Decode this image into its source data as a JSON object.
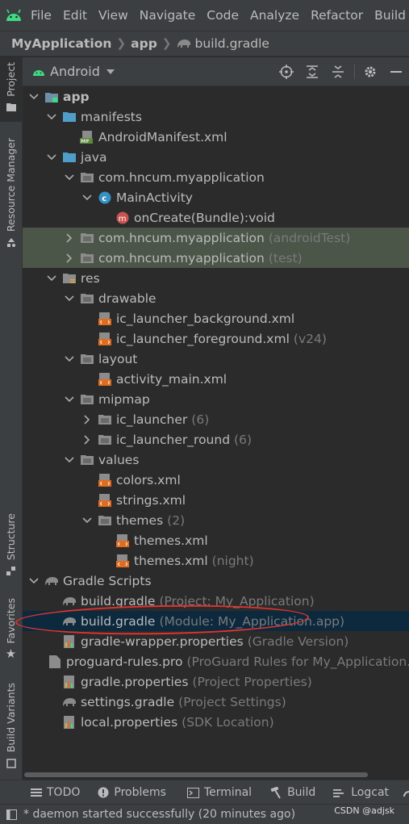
{
  "menu": {
    "items": [
      "File",
      "Edit",
      "View",
      "Navigate",
      "Code",
      "Analyze",
      "Refactor",
      "Build"
    ],
    "underline": [
      "F",
      "E",
      "V",
      "N",
      "C",
      "z",
      "R",
      "B"
    ]
  },
  "breadcrumb": {
    "project": "MyApplication",
    "module": "app",
    "file": "build.gradle"
  },
  "toolwindow": {
    "title": "Android"
  },
  "left_tabs": {
    "project": "Project",
    "resource_manager": "Resource Manager",
    "structure": "Structure",
    "favorites": "Favorites",
    "build_variants": "Build Variants"
  },
  "tree": [
    {
      "label": "app",
      "hint": "",
      "icon": "module-folder-icon",
      "arrow": "down",
      "indent": 0,
      "bold": true
    },
    {
      "label": "manifests",
      "hint": "",
      "icon": "folder-icon",
      "arrow": "down",
      "indent": 1
    },
    {
      "label": "AndroidManifest.xml",
      "hint": "",
      "icon": "manifest-icon",
      "arrow": "",
      "indent": 2
    },
    {
      "label": "java",
      "hint": "",
      "icon": "folder-icon",
      "arrow": "down",
      "indent": 1
    },
    {
      "label": "com.hncum.myapplication",
      "hint": "",
      "icon": "package-icon",
      "arrow": "down",
      "indent": 2
    },
    {
      "label": "MainActivity",
      "hint": "",
      "icon": "class-icon",
      "arrow": "down",
      "indent": 3
    },
    {
      "label": "onCreate(Bundle):void",
      "hint": "",
      "icon": "method-icon",
      "arrow": "",
      "indent": 4
    },
    {
      "label": "com.hncum.myapplication",
      "hint": "(androidTest)",
      "icon": "package-icon",
      "arrow": "right",
      "indent": 2,
      "highlight": "green"
    },
    {
      "label": "com.hncum.myapplication",
      "hint": "(test)",
      "icon": "package-icon",
      "arrow": "right",
      "indent": 2,
      "highlight": "green"
    },
    {
      "label": "res",
      "hint": "",
      "icon": "res-folder-icon",
      "arrow": "down",
      "indent": 1
    },
    {
      "label": "drawable",
      "hint": "",
      "icon": "package-icon",
      "arrow": "down",
      "indent": 2
    },
    {
      "label": "ic_launcher_background.xml",
      "hint": "",
      "icon": "xml-icon",
      "arrow": "",
      "indent": 3
    },
    {
      "label": "ic_launcher_foreground.xml",
      "hint": "(v24)",
      "icon": "xml-icon",
      "arrow": "",
      "indent": 3
    },
    {
      "label": "layout",
      "hint": "",
      "icon": "package-icon",
      "arrow": "down",
      "indent": 2
    },
    {
      "label": "activity_main.xml",
      "hint": "",
      "icon": "xml-icon",
      "arrow": "",
      "indent": 3
    },
    {
      "label": "mipmap",
      "hint": "",
      "icon": "package-icon",
      "arrow": "down",
      "indent": 2
    },
    {
      "label": "ic_launcher",
      "hint": "(6)",
      "icon": "package-icon",
      "arrow": "right",
      "indent": 3
    },
    {
      "label": "ic_launcher_round",
      "hint": "(6)",
      "icon": "package-icon",
      "arrow": "right",
      "indent": 3
    },
    {
      "label": "values",
      "hint": "",
      "icon": "package-icon",
      "arrow": "down",
      "indent": 2
    },
    {
      "label": "colors.xml",
      "hint": "",
      "icon": "xml-icon",
      "arrow": "",
      "indent": 3
    },
    {
      "label": "strings.xml",
      "hint": "",
      "icon": "xml-icon",
      "arrow": "",
      "indent": 3
    },
    {
      "label": "themes",
      "hint": "(2)",
      "icon": "package-icon",
      "arrow": "down",
      "indent": 3
    },
    {
      "label": "themes.xml",
      "hint": "",
      "icon": "xml-icon",
      "arrow": "",
      "indent": 4
    },
    {
      "label": "themes.xml",
      "hint": "(night)",
      "icon": "xml-icon",
      "arrow": "",
      "indent": 4
    },
    {
      "label": "Gradle Scripts",
      "hint": "",
      "icon": "gradle-icon",
      "arrow": "down",
      "indent": 0
    },
    {
      "label": "build.gradle",
      "hint": "(Project: My_Application)",
      "icon": "gradle-icon",
      "arrow": "",
      "indent": 1
    },
    {
      "label": "build.gradle",
      "hint": "(Module: My_Application.app)",
      "icon": "gradle-icon",
      "arrow": "",
      "indent": 1,
      "selected": true
    },
    {
      "label": "gradle-wrapper.properties",
      "hint": "(Gradle Version)",
      "icon": "properties-icon",
      "arrow": "",
      "indent": 1
    },
    {
      "label": "proguard-rules.pro",
      "hint": "(ProGuard Rules for My_Application.app)",
      "icon": "file-icon",
      "arrow": "",
      "indent": 1
    },
    {
      "label": "gradle.properties",
      "hint": "(Project Properties)",
      "icon": "properties-icon",
      "arrow": "",
      "indent": 1
    },
    {
      "label": "settings.gradle",
      "hint": "(Project Settings)",
      "icon": "gradle-icon",
      "arrow": "",
      "indent": 1
    },
    {
      "label": "local.properties",
      "hint": "(SDK Location)",
      "icon": "properties-icon",
      "arrow": "",
      "indent": 1
    }
  ],
  "bottom_tabs": [
    {
      "label": "TODO",
      "icon": "list-icon"
    },
    {
      "label": "Problems",
      "icon": "info-icon"
    },
    {
      "label": "Terminal",
      "icon": "terminal-icon"
    },
    {
      "label": "Build",
      "icon": "hammer-icon"
    },
    {
      "label": "Logcat",
      "icon": "logcat-icon"
    }
  ],
  "status": {
    "message": "* daemon started successfully (20 minutes ago)",
    "watermark": "CSDN @adjsk"
  },
  "colors": {
    "accent_ellipse": "#e0332f",
    "selection": "#0d293e",
    "test_highlight": "#4b5548"
  }
}
